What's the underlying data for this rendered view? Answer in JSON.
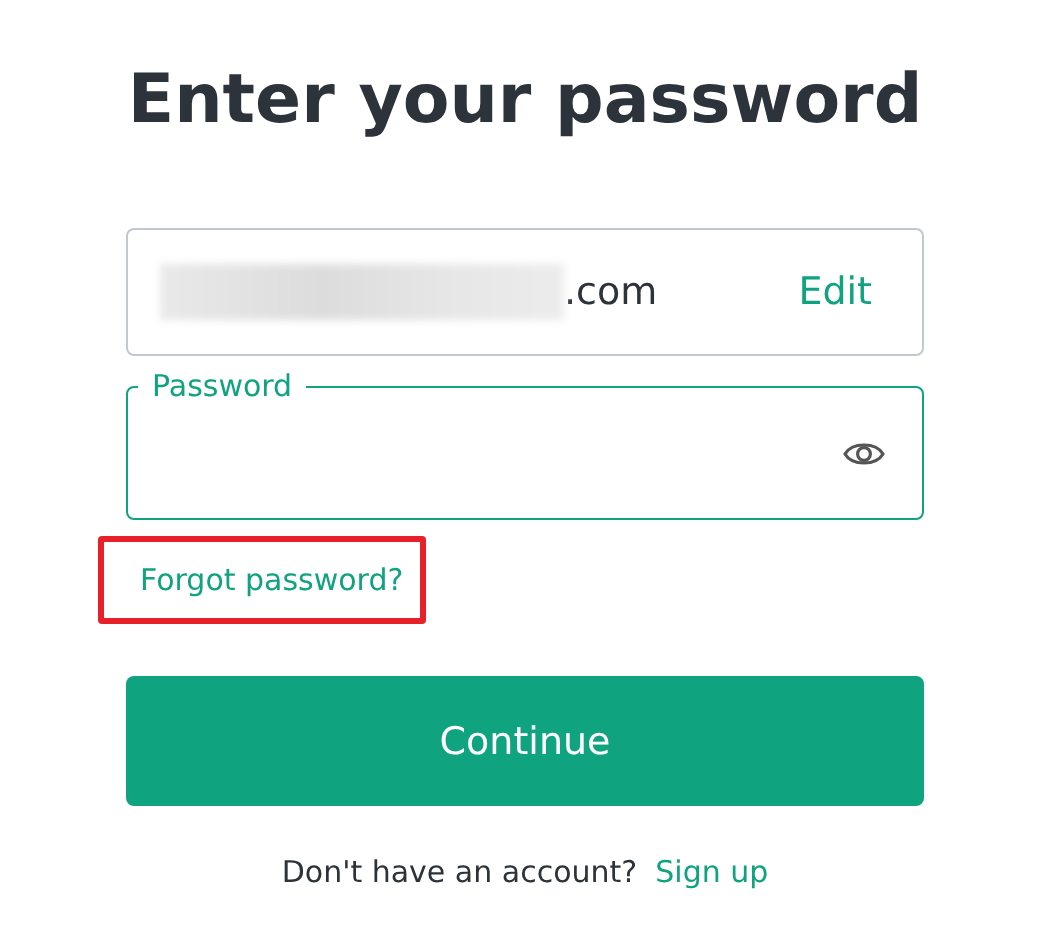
{
  "title": "Enter your password",
  "email_field": {
    "value": ".com",
    "redacted": true,
    "action": "Edit"
  },
  "password_field": {
    "label": "Password",
    "focused": true
  },
  "forgot_link": {
    "text": "Forgot password?",
    "highlighted": true
  },
  "continue_button": "Continue",
  "footer": {
    "text": "Don't have an account?",
    "link": "Sign up"
  }
}
